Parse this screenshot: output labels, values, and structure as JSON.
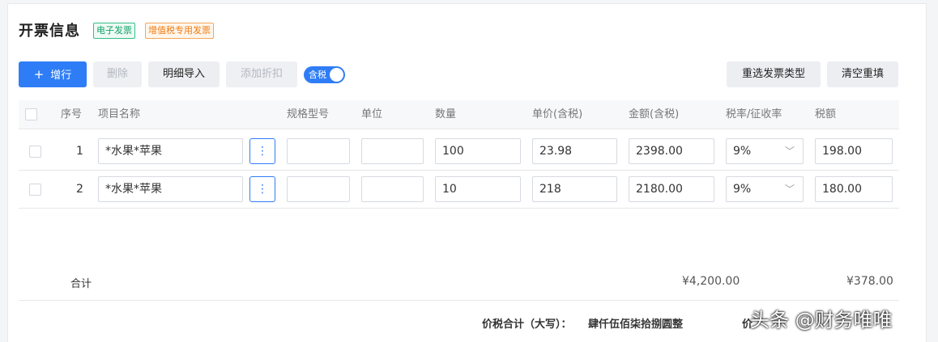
{
  "header": {
    "title": "开票信息",
    "tags": [
      "电子发票",
      "增值税专用发票"
    ]
  },
  "toolbar": {
    "add_label": "增行",
    "add_icon": "plus-icon",
    "delete_label": "删除",
    "import_label": "明细导入",
    "discount_label": "添加折扣",
    "tax_toggle_label": "含税",
    "tax_toggle_on": true,
    "reselect_label": "重选发票类型",
    "clear_label": "清空重填",
    "accent": "#2f7df6"
  },
  "table": {
    "columns": [
      "序号",
      "项目名称",
      "规格型号",
      "单位",
      "数量",
      "单价(含税)",
      "金额(含税)",
      "税率/征收率",
      "税额"
    ],
    "rows": [
      {
        "seq": "1",
        "name": "*水果*苹果",
        "spec": "",
        "unit": "",
        "qty": "100",
        "price": "23.98",
        "amount": "2398.00",
        "rate": "9%",
        "tax": "198.00"
      },
      {
        "seq": "2",
        "name": "*水果*苹果",
        "spec": "",
        "unit": "",
        "qty": "10",
        "price": "218",
        "amount": "2180.00",
        "rate": "9%",
        "tax": "180.00"
      }
    ]
  },
  "totals": {
    "label": "合计",
    "amount": "¥4,200.00",
    "tax": "¥378.00"
  },
  "footer": {
    "total_caps_label": "价税合计（大写）：",
    "total_caps_value": "肆仟伍佰柒拾捌圆整",
    "total_small_label": "价"
  },
  "watermark": "头条 @财务唯唯"
}
